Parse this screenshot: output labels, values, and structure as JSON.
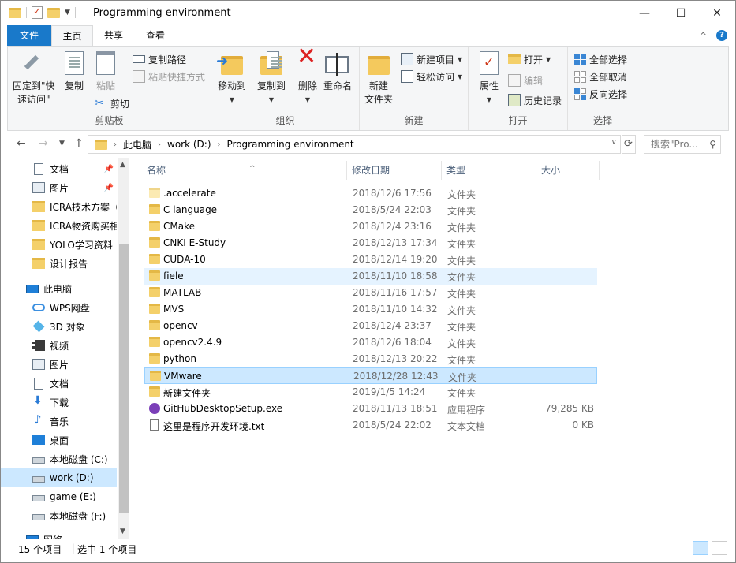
{
  "window": {
    "title": "Programming environment",
    "controls": {
      "minimize": "—",
      "maximize": "☐",
      "close": "✕"
    }
  },
  "tabs": {
    "file": "文件",
    "home": "主页",
    "share": "共享",
    "view": "查看"
  },
  "ribbon": {
    "clipboard": {
      "label": "剪贴板",
      "pin_quick_line1": "固定到\"快",
      "pin_quick_line2": "速访问\"",
      "copy": "复制",
      "paste": "粘贴",
      "copy_path": "复制路径",
      "paste_shortcut": "粘贴快捷方式",
      "cut": "剪切"
    },
    "organize": {
      "label": "组织",
      "move_to": "移动到",
      "copy_to": "复制到",
      "delete": "删除",
      "rename": "重命名"
    },
    "new": {
      "label": "新建",
      "new_folder_line1": "新建",
      "new_folder_line2": "文件夹",
      "new_item": "新建项目",
      "easy_access": "轻松访问"
    },
    "open": {
      "label": "打开",
      "properties": "属性",
      "open": "打开",
      "edit": "编辑",
      "history": "历史记录"
    },
    "select": {
      "label": "选择",
      "select_all": "全部选择",
      "select_none": "全部取消",
      "invert": "反向选择"
    }
  },
  "address": {
    "crumbs": [
      "此电脑",
      "work (D:)",
      "Programming environment"
    ],
    "search_placeholder": "搜索\"Pro..."
  },
  "nav": {
    "items": [
      {
        "label": "文档",
        "pinned": true
      },
      {
        "label": "图片",
        "pinned": true
      },
      {
        "label": "ICRA技术方案（"
      },
      {
        "label": "ICRA物资购买相"
      },
      {
        "label": "YOLO学习资料"
      },
      {
        "label": "设计报告"
      },
      {
        "label": "此电脑"
      },
      {
        "label": "WPS网盘"
      },
      {
        "label": "3D 对象"
      },
      {
        "label": "视频"
      },
      {
        "label": "图片"
      },
      {
        "label": "文档"
      },
      {
        "label": "下载"
      },
      {
        "label": "音乐"
      },
      {
        "label": "桌面"
      },
      {
        "label": "本地磁盘 (C:)"
      },
      {
        "label": "work (D:)",
        "selected": true
      },
      {
        "label": "game (E:)"
      },
      {
        "label": "本地磁盘 (F:)"
      },
      {
        "label": "网络"
      }
    ],
    "pin_glyph": "📌"
  },
  "columns": {
    "name": "名称",
    "date": "修改日期",
    "type": "类型",
    "size": "大小"
  },
  "files": [
    {
      "name": ".accelerate",
      "date": "2018/12/6 17:56",
      "type": "文件夹",
      "size": "",
      "icon": "folder-light"
    },
    {
      "name": "C language",
      "date": "2018/5/24 22:03",
      "type": "文件夹",
      "size": "",
      "icon": "folder"
    },
    {
      "name": "CMake",
      "date": "2018/12/4 23:16",
      "type": "文件夹",
      "size": "",
      "icon": "folder"
    },
    {
      "name": "CNKI E-Study",
      "date": "2018/12/13 17:34",
      "type": "文件夹",
      "size": "",
      "icon": "folder"
    },
    {
      "name": "CUDA-10",
      "date": "2018/12/14 19:20",
      "type": "文件夹",
      "size": "",
      "icon": "folder"
    },
    {
      "name": "fiele",
      "date": "2018/11/10 18:58",
      "type": "文件夹",
      "size": "",
      "icon": "folder",
      "state": "hover"
    },
    {
      "name": "MATLAB",
      "date": "2018/11/16 17:57",
      "type": "文件夹",
      "size": "",
      "icon": "folder"
    },
    {
      "name": "MVS",
      "date": "2018/11/10 14:32",
      "type": "文件夹",
      "size": "",
      "icon": "folder"
    },
    {
      "name": "opencv",
      "date": "2018/12/4 23:37",
      "type": "文件夹",
      "size": "",
      "icon": "folder"
    },
    {
      "name": "opencv2.4.9",
      "date": "2018/12/6 18:04",
      "type": "文件夹",
      "size": "",
      "icon": "folder"
    },
    {
      "name": "python",
      "date": "2018/12/13 20:22",
      "type": "文件夹",
      "size": "",
      "icon": "folder"
    },
    {
      "name": "VMware",
      "date": "2018/12/28 12:43",
      "type": "文件夹",
      "size": "",
      "icon": "folder",
      "state": "selected"
    },
    {
      "name": "新建文件夹",
      "date": "2019/1/5 14:24",
      "type": "文件夹",
      "size": "",
      "icon": "folder"
    },
    {
      "name": "GitHubDesktopSetup.exe",
      "date": "2018/11/13 18:51",
      "type": "应用程序",
      "size": "79,285 KB",
      "icon": "exe"
    },
    {
      "name": "这里是程序开发环境.txt",
      "date": "2018/5/24 22:02",
      "type": "文本文档",
      "size": "0 KB",
      "icon": "txt"
    }
  ],
  "status": {
    "count": "15 个项目",
    "selected": "选中 1 个项目"
  }
}
